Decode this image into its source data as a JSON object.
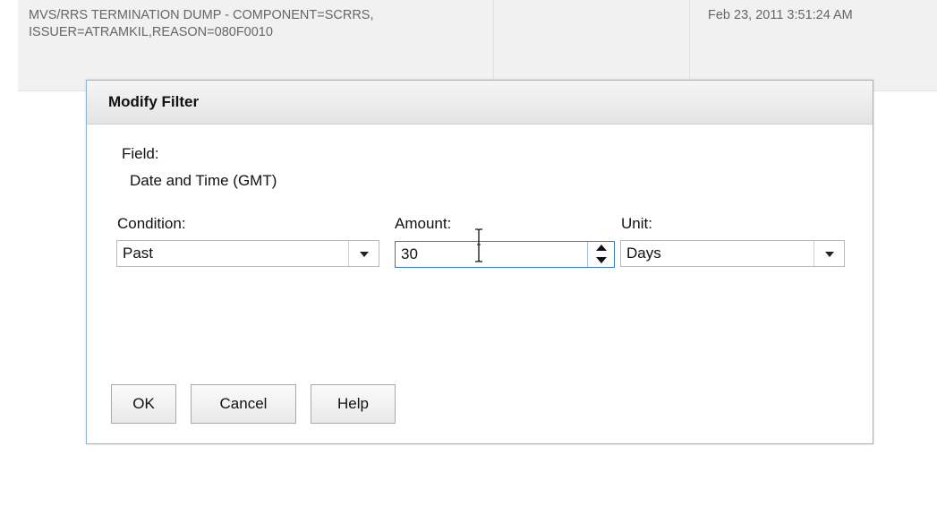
{
  "background_row": {
    "description": "MVS/RRS TERMINATION DUMP - COMPONENT=SCRRS, ISSUER=ATRAMKIL,REASON=080F0010",
    "timestamp": "Feb 23, 2011 3:51:24 AM"
  },
  "dialog": {
    "title": "Modify Filter",
    "field_label": "Field:",
    "field_value": "Date and Time (GMT)",
    "condition": {
      "label": "Condition:",
      "selected": "Past"
    },
    "amount": {
      "label": "Amount:",
      "value": "30"
    },
    "unit": {
      "label": "Unit:",
      "selected": "Days"
    },
    "buttons": {
      "ok": "OK",
      "cancel": "Cancel",
      "help": "Help"
    }
  },
  "colors": {
    "dialog_border": "#8fb3d4",
    "focus_border": "#3a78c9",
    "background_row": "#f1f1f1"
  }
}
